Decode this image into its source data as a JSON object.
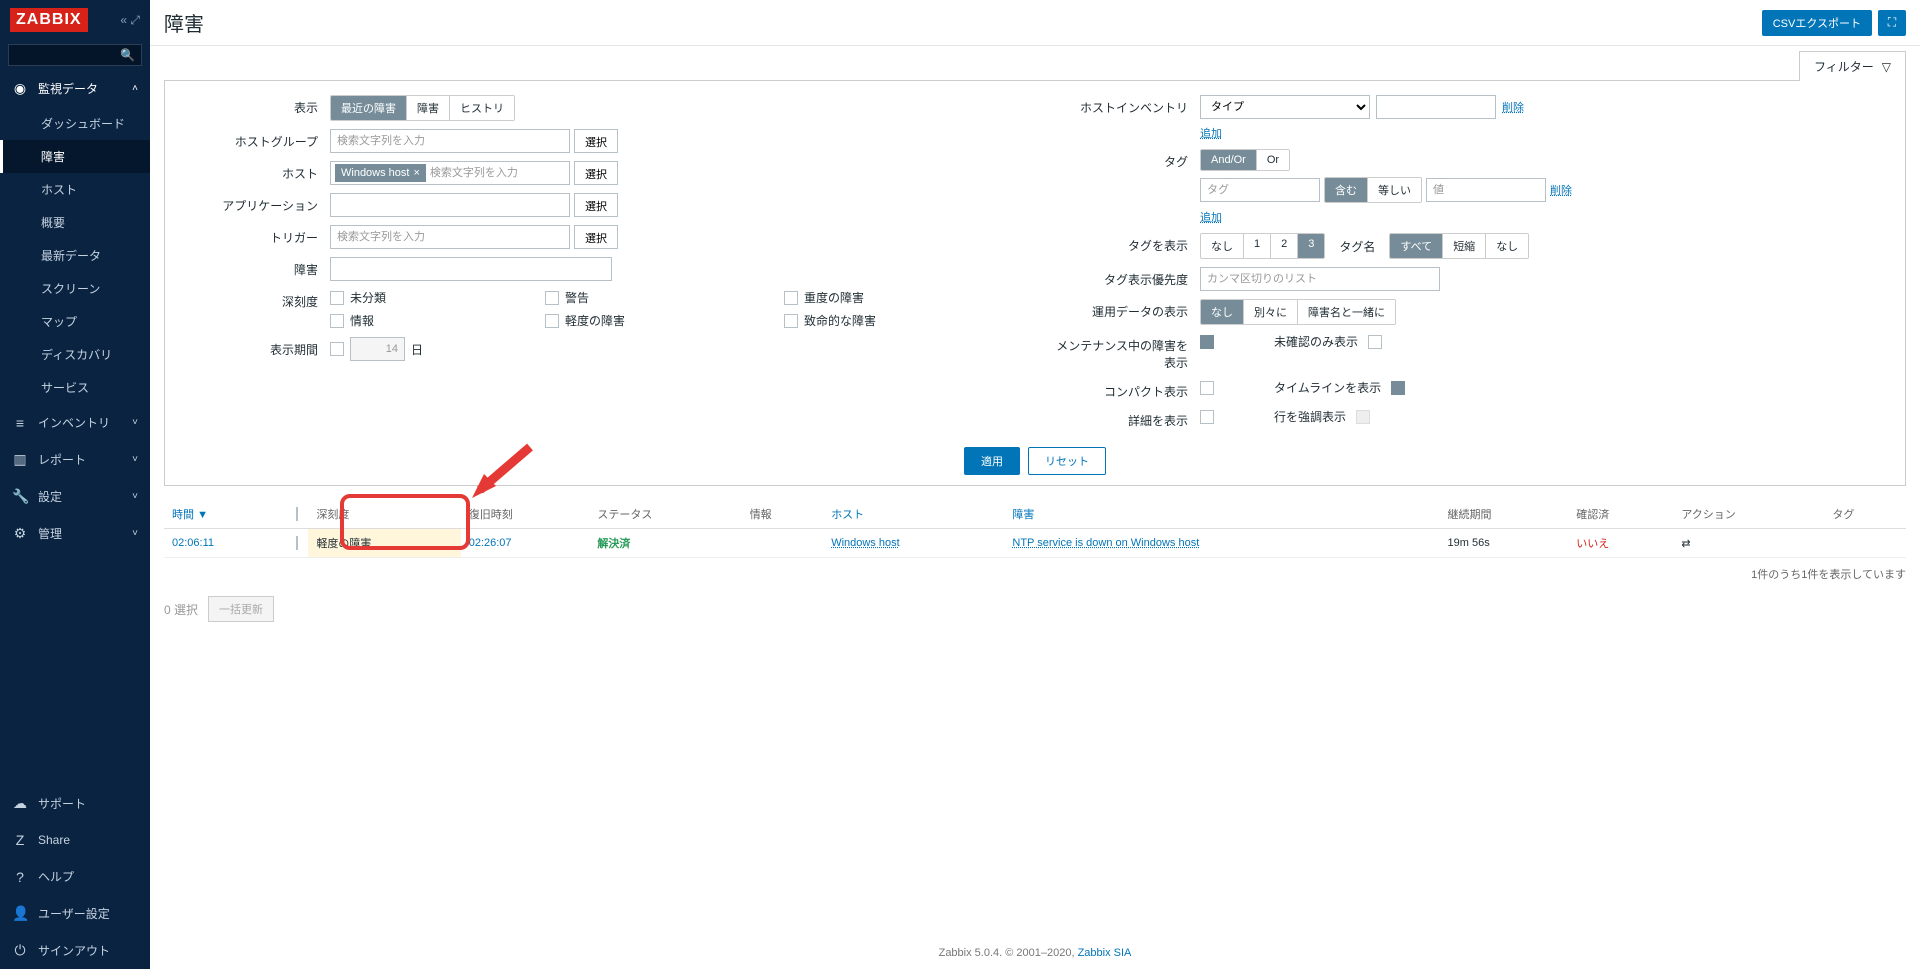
{
  "logo": "ZABBIX",
  "page_title": "障害",
  "csv_button": "CSVエクスポート",
  "filter_tab": "フィルター",
  "sidebar": {
    "sections": [
      {
        "icon": "◉",
        "label": "監視データ",
        "expanded": true,
        "items": [
          "ダッシュボード",
          "障害",
          "ホスト",
          "概要",
          "最新データ",
          "スクリーン",
          "マップ",
          "ディスカバリ",
          "サービス"
        ],
        "active_index": 1
      },
      {
        "icon": "≡",
        "label": "インベントリ",
        "expanded": false
      },
      {
        "icon": "▥",
        "label": "レポート",
        "expanded": false
      },
      {
        "icon": "🔧",
        "label": "設定",
        "expanded": false
      },
      {
        "icon": "⚙",
        "label": "管理",
        "expanded": false
      }
    ],
    "footer": [
      {
        "icon": "☁",
        "label": "サポート"
      },
      {
        "icon": "Z",
        "label": "Share"
      },
      {
        "icon": "?",
        "label": "ヘルプ"
      },
      {
        "icon": "👤",
        "label": "ユーザー設定"
      },
      {
        "icon": "⏻",
        "label": "サインアウト"
      }
    ]
  },
  "filter": {
    "labels": {
      "display": "表示",
      "hostgroup": "ホストグループ",
      "host": "ホスト",
      "application": "アプリケーション",
      "trigger": "トリガー",
      "problem": "障害",
      "severity": "深刻度",
      "age": "表示期間",
      "inventory": "ホストインベントリ",
      "tags": "タグ",
      "showtags": "タグを表示",
      "tagname": "タグ名",
      "tagprio": "タグ表示優先度",
      "opdata": "運用データの表示",
      "maint": "メンテナンス中の障害を表示",
      "unack": "未確認のみ表示",
      "compact": "コンパクト表示",
      "timeline": "タイムラインを表示",
      "details": "詳細を表示",
      "highlight": "行を強調表示"
    },
    "display_options": [
      "最近の障害",
      "障害",
      "ヒストリ"
    ],
    "display_active": 0,
    "placeholder_search": "検索文字列を入力",
    "host_tag": "Windows host",
    "select_btn": "選択",
    "severity_options": [
      "未分類",
      "警告",
      "重度の障害",
      "情報",
      "軽度の障害",
      "致命的な障害"
    ],
    "age_days": "14",
    "age_unit": "日",
    "inventory_type": "タイプ",
    "inventory_delete": "削除",
    "inventory_add": "追加",
    "tag_andor": [
      "And/Or",
      "Or"
    ],
    "tag_andor_active": 0,
    "tag_placeholder": "タグ",
    "tag_cond": [
      "含む",
      "等しい"
    ],
    "tag_cond_active": 0,
    "tag_value_placeholder": "値",
    "tag_delete": "削除",
    "tag_add": "追加",
    "showtags_opts": [
      "なし",
      "1",
      "2",
      "3"
    ],
    "showtags_active": 3,
    "tagname_opts": [
      "すべて",
      "短縮",
      "なし"
    ],
    "tagname_active": 0,
    "tagprio_placeholder": "カンマ区切りのリスト",
    "opdata_opts": [
      "なし",
      "別々に",
      "障害名と一緒に"
    ],
    "opdata_active": 0,
    "apply": "適用",
    "reset": "リセット"
  },
  "table": {
    "headers": {
      "time": "時間",
      "severity": "深刻度",
      "recovery": "復旧時刻",
      "status": "ステータス",
      "info": "情報",
      "host": "ホスト",
      "problem": "障害",
      "duration": "継続期間",
      "ack": "確認済",
      "actions": "アクション",
      "tags": "タグ"
    },
    "sort_indicator": "▼",
    "rows": [
      {
        "time": "02:06:11",
        "severity": "軽度の障害",
        "recovery": "02:26:07",
        "status": "解決済",
        "host": "Windows host",
        "problem": "NTP service is down on Windows host",
        "duration": "19m 56s",
        "ack": "いいえ",
        "action_icon": "⇄"
      }
    ],
    "footer": "1件のうち1件を表示しています"
  },
  "bulk": {
    "selected": "0 選択",
    "button": "一括更新"
  },
  "footer": {
    "text": "Zabbix 5.0.4. © 2001–2020, ",
    "link": "Zabbix SIA"
  }
}
